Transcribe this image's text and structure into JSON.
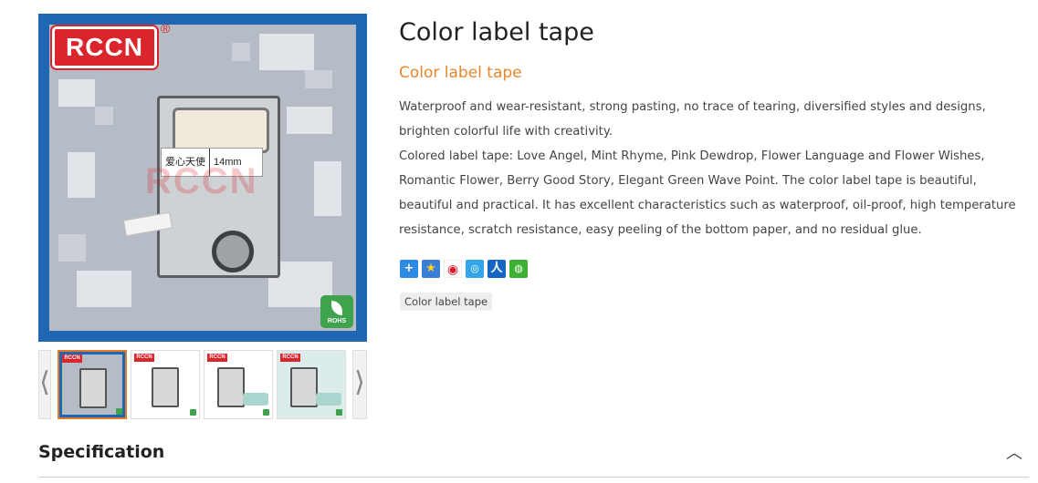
{
  "product": {
    "title": "Color label tape",
    "subtitle": "Color label tape",
    "description": [
      "Waterproof and wear-resistant, strong pasting, no trace of tearing, diversified styles and designs, brighten colorful life with creativity.",
      "Colored label tape: Love Angel, Mint Rhyme, Pink Dewdrop, Flower Language and Flower Wishes, Romantic Flower, Berry Good Story, Elegant Green Wave Point. The color label tape is beautiful, beautiful and practical. It has excellent characteristics such as waterproof, oil-proof, high temperature resistance, scratch resistance, easy peeling of the bottom paper, and no residual glue."
    ],
    "tag": "Color label tape"
  },
  "main_image": {
    "brand": "RCCN",
    "registered": "®",
    "label_text": "爱心天使",
    "label_size": "14mm",
    "watermark": "RCCN",
    "badge": "ROHS"
  },
  "thumbnails": {
    "prev_glyph": "⟨",
    "next_glyph": "⟩",
    "brand": "RCCN",
    "items": [
      {
        "active": true
      },
      {
        "active": false
      },
      {
        "active": false
      },
      {
        "active": false
      }
    ]
  },
  "share_icons": [
    {
      "name": "share-plus-icon",
      "glyph": "+"
    },
    {
      "name": "bookmark-star-icon",
      "glyph": "★"
    },
    {
      "name": "weibo-icon",
      "glyph": "◉"
    },
    {
      "name": "tencent-weibo-icon",
      "glyph": "◎"
    },
    {
      "name": "renren-icon",
      "glyph": "人"
    },
    {
      "name": "wechat-icon",
      "glyph": "◍"
    }
  ],
  "specification": {
    "title": "Specification",
    "toggle_glyph": "︿"
  },
  "colors": {
    "accent": "#e8862e",
    "image_frame": "#1f67b3",
    "brand_red": "#d9252b"
  }
}
